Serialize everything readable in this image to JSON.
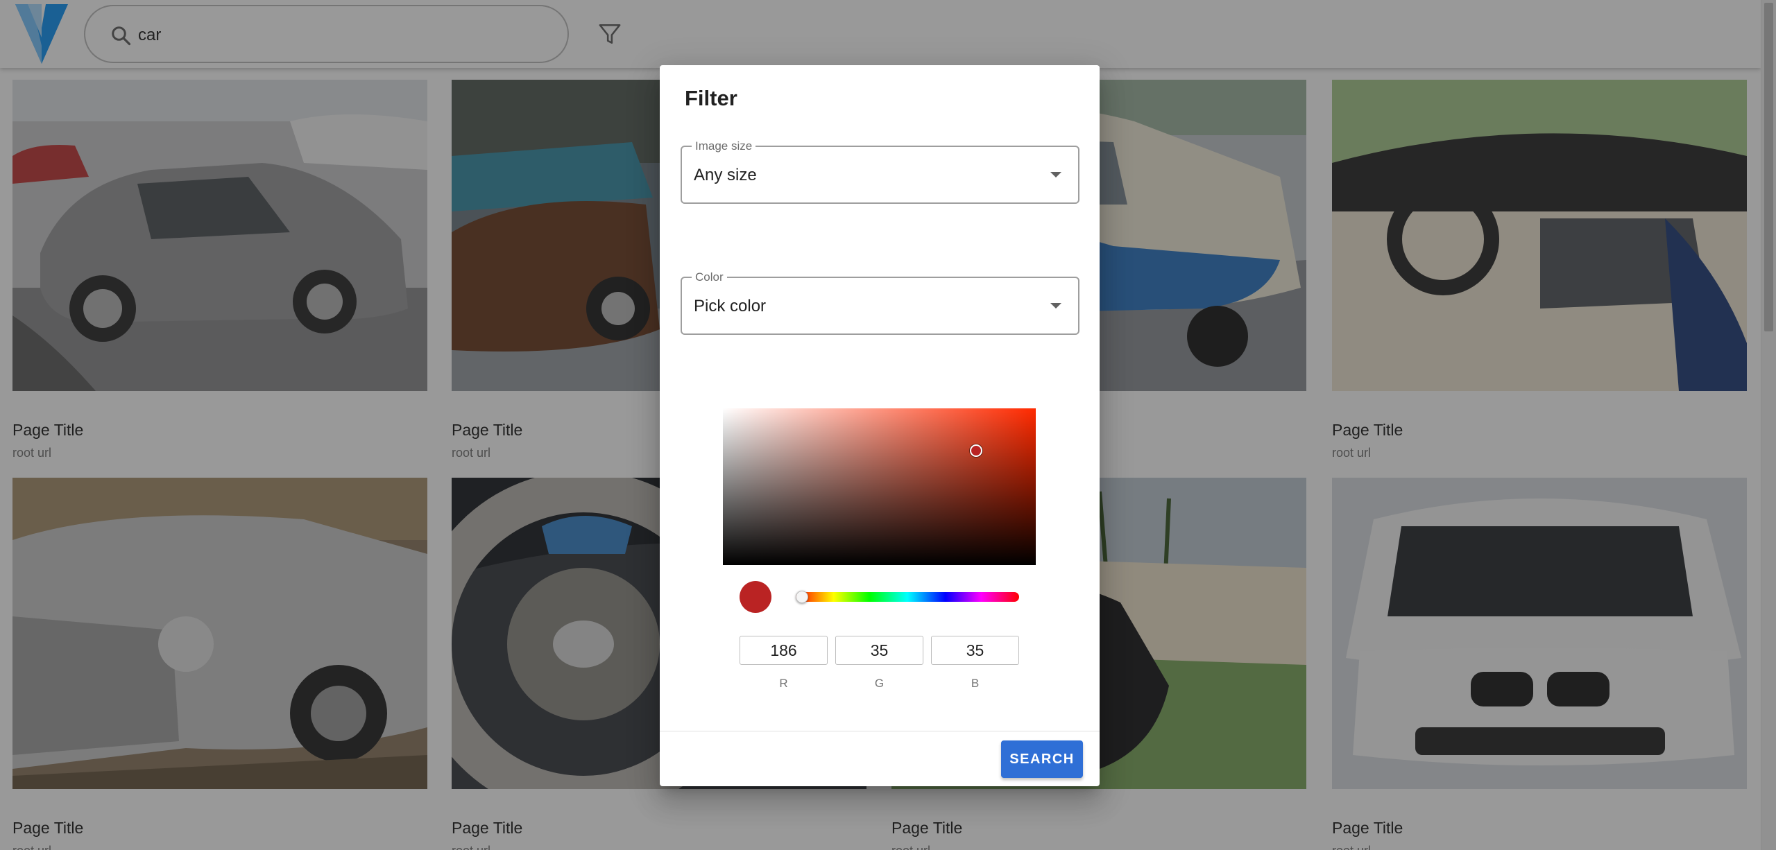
{
  "search": {
    "value": "car",
    "icon": "search-icon"
  },
  "filter_icon": "filter-icon",
  "cards": [
    {
      "title": "Page Title",
      "url": "root url",
      "image": "gray sports coupe in parking lot"
    },
    {
      "title": "Page Title",
      "url": "root url",
      "image": "classic cars at outdoor show"
    },
    {
      "title": "",
      "url": "",
      "image": "vintage blue and white sedan"
    },
    {
      "title": "Page Title",
      "url": "root url",
      "image": "convertible interior with steering wheel"
    },
    {
      "title": "Page Title",
      "url": "root url",
      "image": "silver classic roadster"
    },
    {
      "title": "Page Title",
      "url": "root url",
      "image": "steering wheel and dashboard"
    },
    {
      "title": "Page Title",
      "url": "root url",
      "image": "black vintage car at palm show"
    },
    {
      "title": "Page Title",
      "url": "root url",
      "image": "white car with open hood"
    }
  ],
  "dialog": {
    "title": "Filter",
    "image_size": {
      "label": "Image size",
      "value": "Any size"
    },
    "color": {
      "label": "Color",
      "value": "Pick color"
    },
    "picker": {
      "hue_color": "#ff2a00",
      "saturation": 0.81,
      "brightness": 0.73,
      "hue_position": 0.0,
      "swatch_color": "#ba2323"
    },
    "rgb": {
      "r": "186",
      "g": "35",
      "b": "35",
      "r_label": "R",
      "g_label": "G",
      "b_label": "B"
    },
    "search_button": "SEARCH"
  },
  "colors": {
    "accent": "#2f6fd6",
    "overlay": "rgba(33,33,33,0.46)"
  }
}
